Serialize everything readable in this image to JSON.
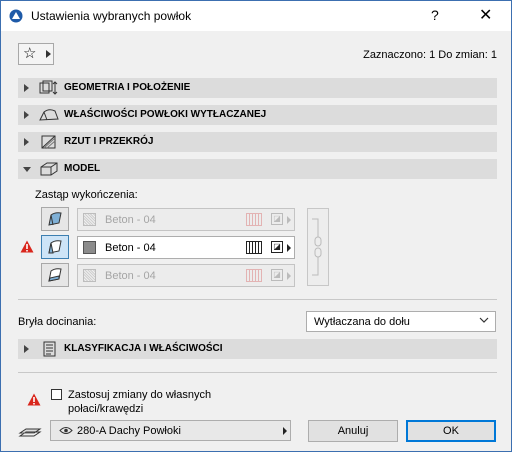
{
  "window": {
    "title": "Ustawienia wybranych powłok",
    "help_label": "?",
    "close_label": "✕"
  },
  "header": {
    "selection_info": "Zaznaczono: 1 Do zmian: 1",
    "favorites_icon": "star-icon"
  },
  "sections": {
    "geometry": "GEOMETRIA I POŁOŻENIE",
    "properties": "WŁAŚCIWOŚCI POWŁOKI WYTŁACZANEJ",
    "plan": "RZUT I PRZEKRÓJ",
    "model": "MODEL",
    "classification": "KLASYFIKACJA I WŁAŚCIWOŚCI"
  },
  "model": {
    "override_label": "Zastąp wykończenia:",
    "finishes": [
      {
        "name": "Beton - 04",
        "active": false
      },
      {
        "name": "Beton - 04",
        "active": true
      },
      {
        "name": "Beton - 04",
        "active": false
      }
    ]
  },
  "trim": {
    "label": "Bryła docinania:",
    "value": "Wytłaczana do dołu"
  },
  "footer": {
    "apply_label_line1": "Zastosuj zmiany do własnych",
    "apply_label_line2": "połaci/krawędzi",
    "apply_checked": false,
    "layer": "280-A Dachy Powłoki",
    "cancel_label": "Anuluj",
    "ok_label": "OK"
  },
  "colors": {
    "section_bg": "#dcdcdc",
    "selected_btn": "#cde4f7",
    "accent": "#0078d7",
    "warning": "#d9261c"
  }
}
